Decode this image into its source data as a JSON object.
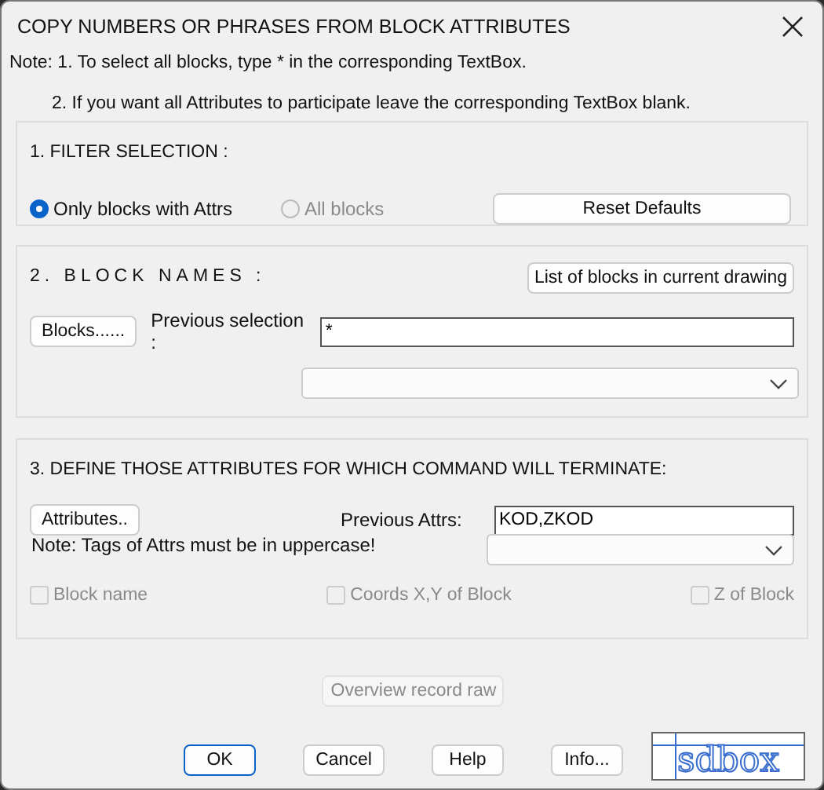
{
  "window": {
    "title": "COPY NUMBERS OR PHRASES FROM BLOCK ATTRIBUTES"
  },
  "notes": [
    "Note: 1. To select all blocks, type * in the corresponding TextBox.",
    "2. If you want all Attributes to participate leave the corresponding TextBox blank."
  ],
  "filter_selection": {
    "heading": "1.  FILTER SELECTION :",
    "options": [
      {
        "label": "Only blocks with Attrs",
        "selected": true,
        "disabled": false
      },
      {
        "label": "All blocks",
        "selected": false,
        "disabled": true
      }
    ],
    "reset_button": "Reset Defaults"
  },
  "block_names": {
    "heading": "2. BLOCK NAMES  :",
    "list_button": "List of blocks in current drawing",
    "blocks_button": "Blocks......",
    "previous_label": "Previous selection :",
    "previous_value": "*"
  },
  "attributes": {
    "heading": "3.  DEFINE THOSE ATTRIBUTES FOR WHICH COMMAND WILL TERMINATE:",
    "attributes_button": "Attributes..",
    "previous_label": "Previous Attrs:",
    "previous_value": "KOD,ZKOD",
    "note": "Note: Tags of Attrs must be in uppercase!",
    "checkboxes": [
      {
        "label": "Block name",
        "checked": false,
        "disabled": true
      },
      {
        "label": "Coords X,Y of Block",
        "checked": false,
        "disabled": true
      },
      {
        "label": "Z of Block",
        "checked": false,
        "disabled": true
      }
    ]
  },
  "overview_button": {
    "label": "Overview record raw",
    "disabled": true
  },
  "buttons": [
    {
      "label": "OK",
      "default": true
    },
    {
      "label": "Cancel",
      "default": false
    },
    {
      "label": "Help",
      "default": false
    },
    {
      "label": "Info...",
      "default": false
    }
  ],
  "logo": {
    "text": "sdbox"
  }
}
